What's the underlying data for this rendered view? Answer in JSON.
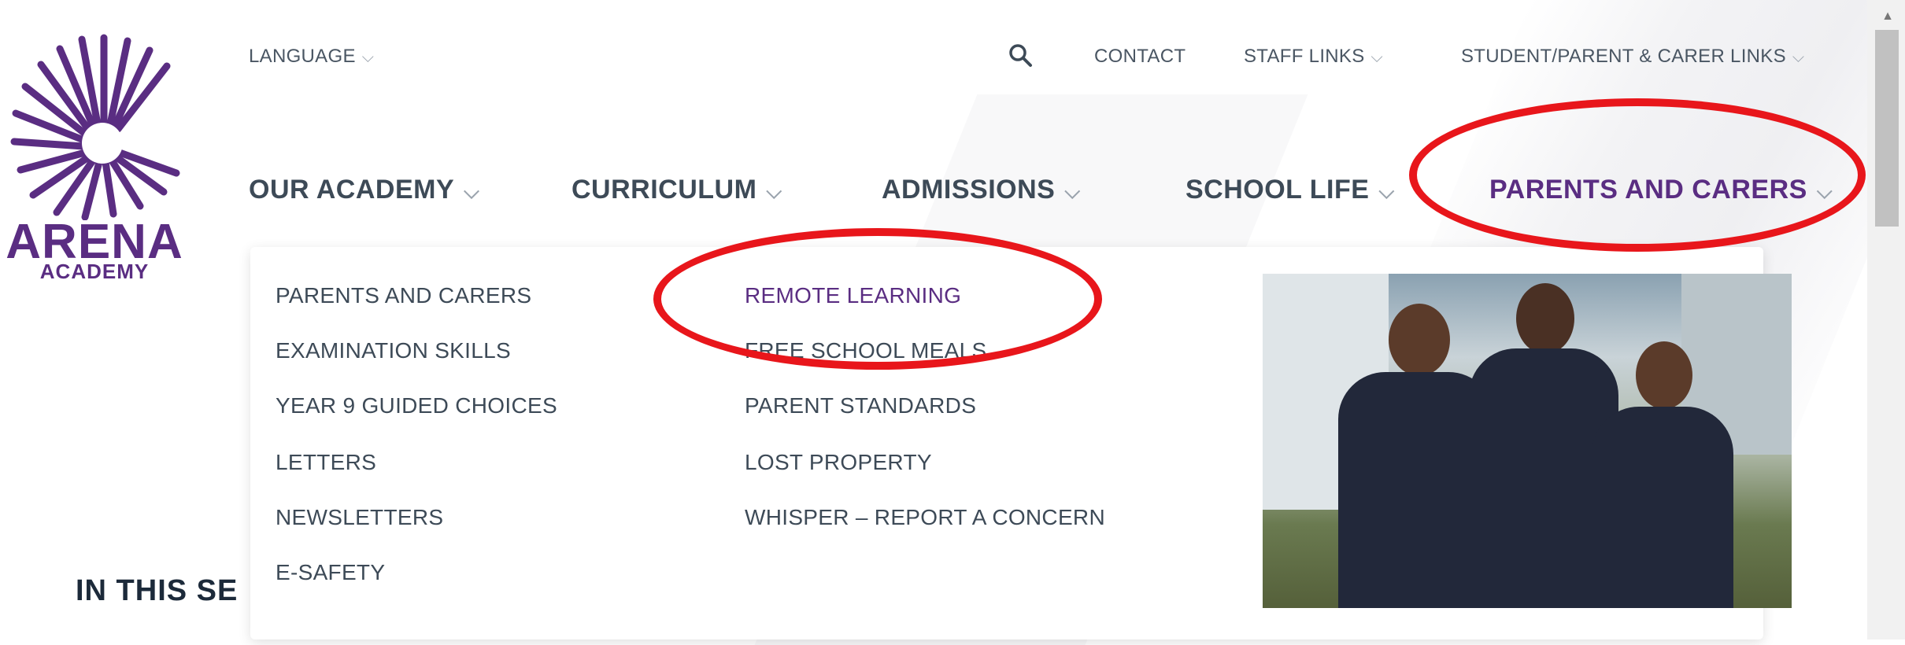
{
  "brand": {
    "name": "ARENA",
    "sub": "ACADEMY",
    "color": "#5a2d82"
  },
  "utility_nav": {
    "language": "LANGUAGE",
    "search_icon": "search-icon",
    "contact": "CONTACT",
    "staff_links": "STAFF LINKS",
    "student_parent_links": "STUDENT/PARENT & CARER LINKS"
  },
  "main_nav": {
    "items": [
      {
        "label": "OUR ACADEMY"
      },
      {
        "label": "CURRICULUM"
      },
      {
        "label": "ADMISSIONS"
      },
      {
        "label": "SCHOOL LIFE"
      },
      {
        "label": "PARENTS AND CARERS",
        "active": true
      }
    ]
  },
  "dropdown": {
    "col1": [
      "PARENTS AND CARERS",
      "EXAMINATION SKILLS",
      "YEAR 9 GUIDED CHOICES",
      "LETTERS",
      "NEWSLETTERS",
      "E-SAFETY"
    ],
    "col2": [
      "REMOTE LEARNING",
      "FREE SCHOOL MEALS",
      "PARENT STANDARDS",
      "LOST PROPERTY",
      "WHISPER – REPORT A CONCERN"
    ]
  },
  "page": {
    "section_title": "IN THIS SE"
  },
  "colors": {
    "accent": "#5a2d82",
    "annotation": "#e8161b",
    "text": "#3d4a57"
  }
}
